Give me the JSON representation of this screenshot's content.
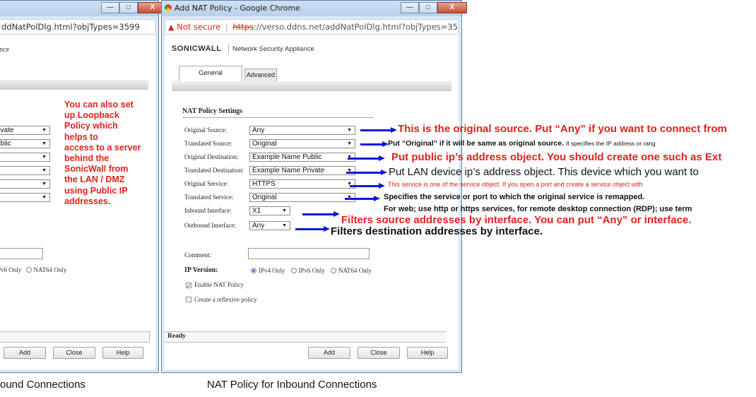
{
  "left_window": {
    "address": "ddNatPolDlg.html?objTypes=3599",
    "header_fragment": "nce",
    "annotation_lines": [
      "You can also set",
      "up Loopback",
      "Policy which",
      "helps to",
      "access to a server",
      "behind the",
      "SonicWall from",
      "the LAN / DMZ",
      "using Public IP",
      "addresses."
    ],
    "fields": [
      {
        "value": "rivate"
      },
      {
        "value": "ublic"
      },
      {
        "value": ""
      },
      {
        "value": ""
      },
      {
        "value": ""
      },
      {
        "value": ""
      }
    ],
    "ip_version_fragment": "IPv6 Only",
    "nat64_label": "NAT64 Only",
    "buttons": {
      "add": "Add",
      "close": "Close",
      "help": "Help"
    },
    "caption": "ound Connections"
  },
  "right_window": {
    "title": "Add NAT Policy - Google Chrome",
    "not_secure": "Not secure",
    "url_scheme": "https",
    "url_rest": "://verso.ddns.net/addNatPolDlg.html?objTypes=3599",
    "logo": "SONICWALL",
    "product": "Network Security Appliance",
    "tabs": {
      "general": "General",
      "advanced": "Advanced"
    },
    "section_title": "NAT Policy Settings",
    "fields": [
      {
        "label": "Original Source:",
        "value": "Any"
      },
      {
        "label": "Translated Source:",
        "value": "Original"
      },
      {
        "label": "Original Destination:",
        "value": "Example Name Public"
      },
      {
        "label": "Translated Destination:",
        "value": "Example Name Private"
      },
      {
        "label": "Original Service:",
        "value": "HTTPS"
      },
      {
        "label": "Translated Service:",
        "value": "Original"
      },
      {
        "label": "Inbound Interface:",
        "value": "X1"
      },
      {
        "label": "Outbound Interface:",
        "value": "Any"
      }
    ],
    "comment_label": "Comment:",
    "ip_version_label": "IP Version:",
    "ip_options": [
      "IPv4 Only",
      "IPv6 Only",
      "NAT64 Only"
    ],
    "enable_nat": "Enable NAT Policy",
    "reflexive": "Create a reflexive policy",
    "status": "Ready",
    "buttons": {
      "add": "Add",
      "close": "Close",
      "help": "Help"
    },
    "caption": "NAT Policy for Inbound Connections"
  },
  "annotations": {
    "original_source": "This is the original source. Put “Any” if you want to connect from",
    "translated_source_a": "Put “Original” if it will be same as original source.",
    "translated_source_b": "It specifies the IP address or rang",
    "original_destination": "Put public ip’s address object. You should create one such as Ext",
    "translated_destination": "Put LAN device ip’s address object. This device which you want to",
    "original_service": "This service is one of the service object. If you open a port and create a service object with",
    "translated_service": "Specifies the service or port to which the original service is remapped.",
    "web_note": "For web; use http or https services, for remote desktop connection (RDP); use term",
    "inbound": "Filters source addresses by interface. You can put “Any” or interface.",
    "outbound": "Filters destination addresses by interface."
  },
  "colors": {
    "annotation_red": "#e2211c",
    "arrow_blue": "#0a1bd6",
    "nat_red": "#d9261c"
  }
}
